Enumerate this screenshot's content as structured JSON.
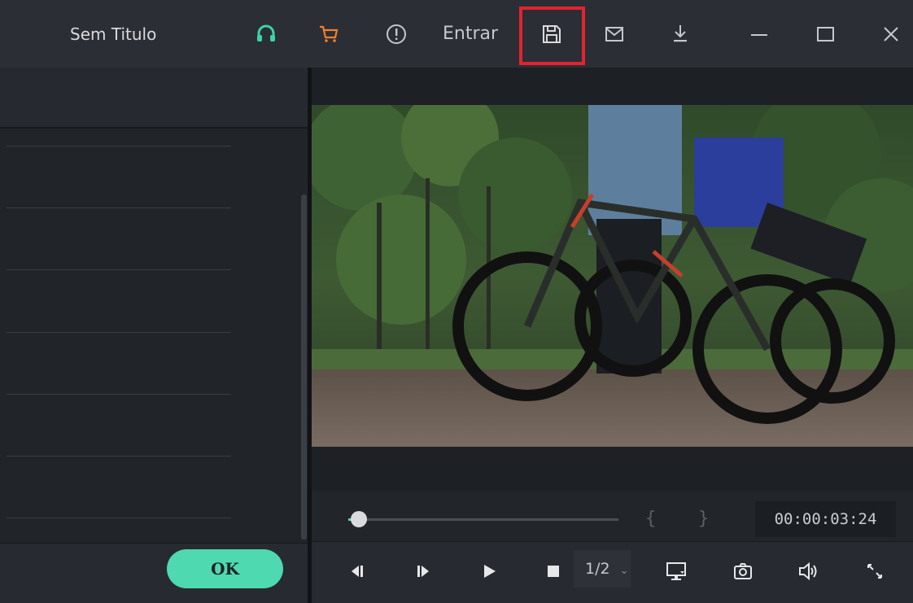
{
  "window": {
    "title": "Sem Titulo",
    "login_label": "Entrar",
    "icons": [
      "headset-icon",
      "cart-icon",
      "alert-icon",
      "save-icon",
      "mail-icon",
      "download-icon",
      "minimize-icon",
      "maximize-icon",
      "close-icon"
    ]
  },
  "left_panel": {
    "ok_label": "OK"
  },
  "player": {
    "timecode": "00:00:03:24",
    "speed": "1/2",
    "mark_in": "{",
    "mark_out": "}",
    "progress": 0.04
  },
  "colors": {
    "accent": "#4fd9b0",
    "cart": "#f07f2c",
    "headset": "#3ed2a8",
    "highlight": "#e3232f"
  }
}
